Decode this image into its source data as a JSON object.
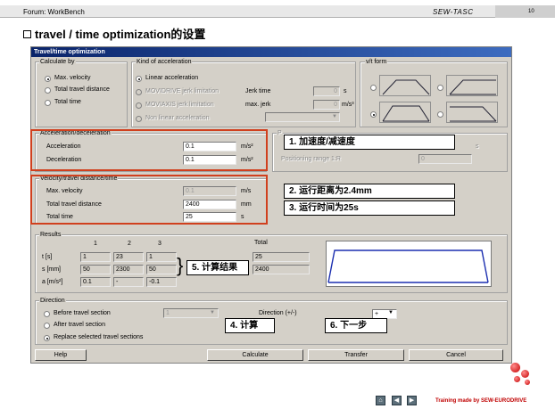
{
  "slide": {
    "header_left": "Forum: WorkBench",
    "header_center": "SEW-TASC",
    "page_number": "10",
    "title": "travel / time optimization的设置",
    "footer_credit": "Training made by SEW-EURODRIVE"
  },
  "dialog": {
    "title": "Travel/time optimization",
    "calculate_by": {
      "legend": "Calculate by",
      "options": [
        "Max. velocity",
        "Total travel distance",
        "Total time"
      ],
      "selected": "Max. velocity"
    },
    "kind_of_acceleration": {
      "legend": "Kind of acceleration",
      "options": [
        "Linear acceleration",
        "MOVIDRIVE jerk limitation",
        "MOVIAXIS jerk limitation",
        "Non linear acceleration"
      ],
      "selected": "Linear acceleration",
      "jerk_time_label": "Jerk time",
      "jerk_time_value": "0",
      "jerk_time_unit": "s",
      "max_jerk_label": "max. jerk",
      "max_jerk_value": "0",
      "max_jerk_unit": "m/s³"
    },
    "vt_form": {
      "legend": "v/t form",
      "selected_index": 2
    },
    "acceleration": {
      "legend": "Acceleration/deceleration",
      "acceleration_label": "Acceleration",
      "acceleration_value": "0.1",
      "acceleration_unit": "m/s²",
      "deceleration_label": "Deceleration",
      "deceleration_value": "0.1",
      "deceleration_unit": "m/s²"
    },
    "positioning": {
      "fragment_text": "P",
      "unit_s": "s",
      "range_label": "Positioning range 1:R",
      "range_value": "0"
    },
    "velocity": {
      "legend": "Velocity/travel distance/time",
      "max_velocity_label": "Max. velocity",
      "max_velocity_value": "0.1",
      "max_velocity_unit": "m/s",
      "distance_label": "Total travel distance",
      "distance_value": "2400",
      "distance_unit": "mm",
      "time_label": "Total time",
      "time_value": "25",
      "time_unit": "s"
    },
    "results": {
      "legend": "Results",
      "columns": [
        "1",
        "2",
        "3"
      ],
      "total_label": "Total",
      "rows": [
        {
          "label": "t [s]",
          "values": [
            "1",
            "23",
            "1"
          ],
          "total": "25"
        },
        {
          "label": "s [mm]",
          "values": [
            "50",
            "2300",
            "50"
          ],
          "total": "2400"
        },
        {
          "label": "a [m/s²]",
          "values": [
            "0.1",
            "-",
            "-0.1"
          ],
          "total": ""
        }
      ]
    },
    "direction": {
      "legend": "Direction",
      "options": [
        "Before travel section",
        "After travel section",
        "Replace selected travel sections"
      ],
      "selected": "Replace selected travel sections",
      "section_select_value": "1",
      "direction_label": "Direction (+/-)",
      "direction_value": "+"
    },
    "buttons": {
      "help": "Help",
      "calculate": "Calculate",
      "transfer": "Transfer",
      "cancel": "Cancel"
    }
  },
  "annotations": {
    "accel": "1. 加速度/减速度",
    "distance": "2. 运行距离为2.4mm",
    "time": "3. 运行时间为25s",
    "calculate": "4. 计算",
    "results": "5. 计算结果",
    "next": "6. 下一步"
  },
  "colors": {
    "highlight": "#d0401e",
    "titlebar": "#0a246a",
    "dialog_bg": "#d4d0c8"
  }
}
